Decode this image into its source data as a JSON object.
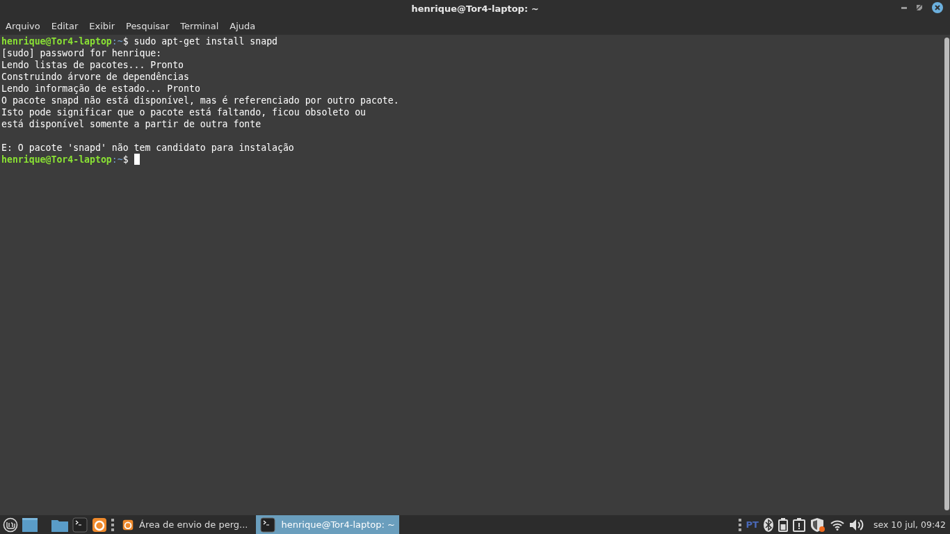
{
  "window": {
    "title": "henrique@Tor4-laptop: ~"
  },
  "menu": [
    "Arquivo",
    "Editar",
    "Exibir",
    "Pesquisar",
    "Terminal",
    "Ajuda"
  ],
  "terminal": {
    "lines": [
      {
        "kind": "prompt",
        "user_host": "henrique@Tor4-laptop",
        "path": ":~",
        "symbol": "$",
        "command": "sudo apt-get install snapd",
        "cursor": false
      },
      {
        "kind": "output",
        "text": "[sudo] password for henrique:"
      },
      {
        "kind": "output",
        "text": "Lendo listas de pacotes... Pronto"
      },
      {
        "kind": "output",
        "text": "Construindo árvore de dependências"
      },
      {
        "kind": "output",
        "text": "Lendo informação de estado... Pronto"
      },
      {
        "kind": "output",
        "text": "O pacote snapd não está disponível, mas é referenciado por outro pacote."
      },
      {
        "kind": "output",
        "text": "Isto pode significar que o pacote está faltando, ficou obsoleto ou"
      },
      {
        "kind": "output",
        "text": "está disponível somente a partir de outra fonte"
      },
      {
        "kind": "blank"
      },
      {
        "kind": "output",
        "text": "E: O pacote 'snapd' não tem candidato para instalação"
      },
      {
        "kind": "prompt",
        "user_host": "henrique@Tor4-laptop",
        "path": ":~",
        "symbol": "$",
        "cursor": true
      }
    ]
  },
  "taskbar": {
    "windows": [
      {
        "kind": "browser",
        "label": "Área de envio de perg...",
        "selected": false
      },
      {
        "kind": "terminal",
        "label": "henrique@Tor4-laptop: ~",
        "selected": true
      }
    ],
    "keyboard_layout": "PT",
    "clock": "sex 10 jul, 09:42"
  }
}
